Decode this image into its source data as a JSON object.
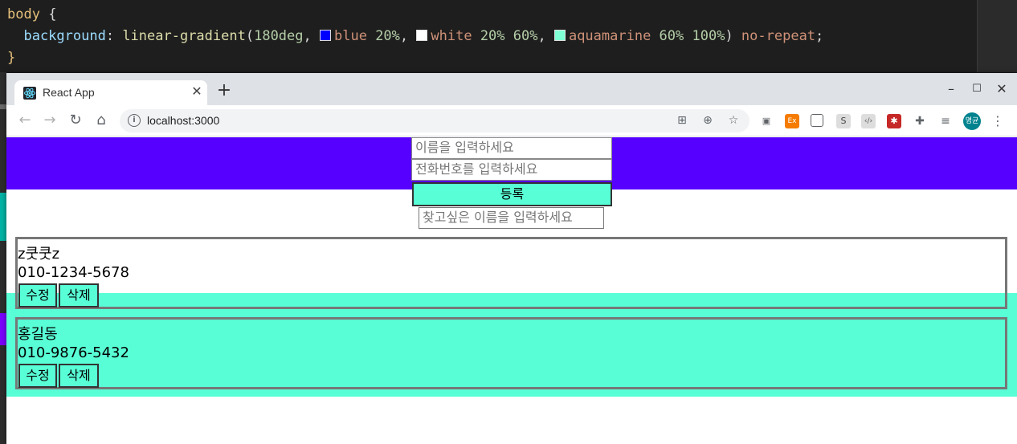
{
  "editor": {
    "line1_selector": "body",
    "line1_brace": " {",
    "line2_prop": "  background",
    "line2_colon": ": ",
    "line2_fn": "linear-gradient",
    "line2_open": "(",
    "line2_angle": "180deg",
    "line2_comma1": ", ",
    "color1_name": "blue",
    "color1_stop": " 20%",
    "line2_comma2": ", ",
    "color2_name": "white",
    "color2_stop": " 20% 60%",
    "line2_comma3": ", ",
    "color3_name": "aquamarine",
    "color3_stop": " 60% 100%",
    "line2_close": ") ",
    "line2_repeat": "no-repeat",
    "line2_semi": ";",
    "line3_brace": "}",
    "swatch_colors": [
      "#0000ff",
      "#ffffff",
      "#7fffd4"
    ]
  },
  "browser": {
    "tab_title": "React App",
    "tab_close": "✕",
    "new_tab": "+",
    "minimize": "–",
    "maximize": "☐",
    "close": "✕",
    "url": "localhost:3000",
    "avatar_text": "명균"
  },
  "page": {
    "name_placeholder": "이름을 입력하세요",
    "phone_placeholder": "전화번호를 입력하세요",
    "register_label": "등록",
    "search_placeholder": "찾고싶은 이름을 입력하세요",
    "contacts": [
      {
        "name": "z쿳쿳z",
        "phone": "010-1234-5678",
        "edit_label": "수정",
        "delete_label": "삭제"
      },
      {
        "name": "홍길동",
        "phone": "010-9876-5432",
        "edit_label": "수정",
        "delete_label": "삭제"
      }
    ]
  },
  "colors": {
    "band_blue": "#5600ff",
    "band_aqua": "#58ffd6"
  }
}
